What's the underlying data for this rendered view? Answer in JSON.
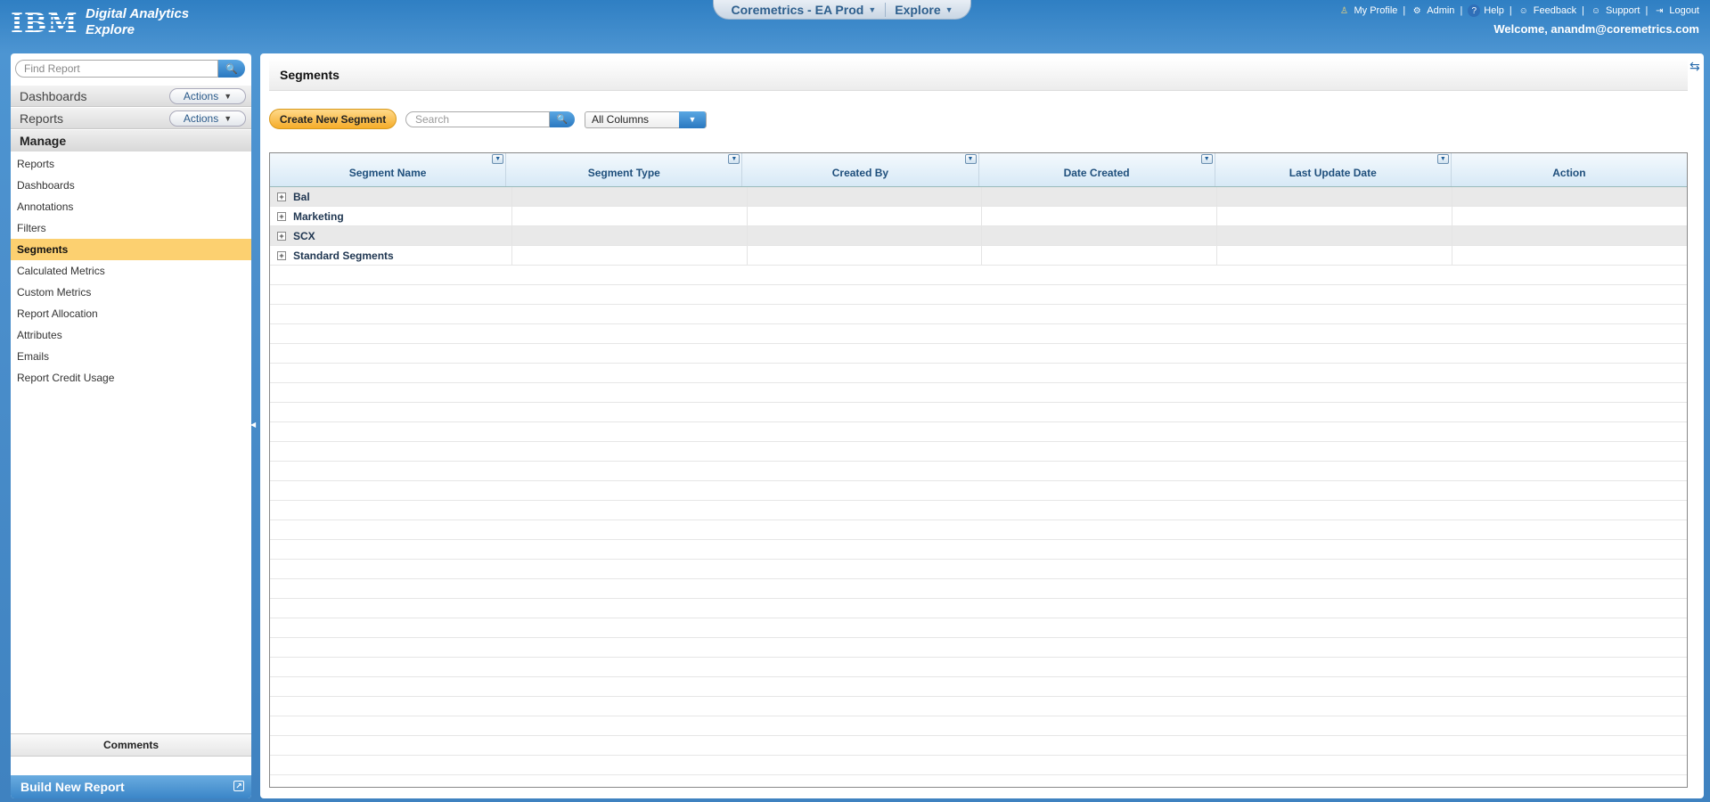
{
  "header": {
    "logo": "IBM",
    "brand_line1": "Digital Analytics",
    "brand_line2": "Explore",
    "center_tabs": [
      {
        "label": "Coremetrics - EA Prod"
      },
      {
        "label": "Explore"
      }
    ],
    "links": [
      {
        "label": "My Profile",
        "icon": "user-icon"
      },
      {
        "label": "Admin",
        "icon": "gear-icon"
      },
      {
        "label": "Help",
        "icon": "help-icon"
      },
      {
        "label": "Feedback",
        "icon": "feedback-icon"
      },
      {
        "label": "Support",
        "icon": "support-icon"
      },
      {
        "label": "Logout",
        "icon": "logout-icon"
      }
    ],
    "welcome": "Welcome, anandm@coremetrics.com"
  },
  "sidebar": {
    "find_placeholder": "Find Report",
    "dashboards_label": "Dashboards",
    "reports_label": "Reports",
    "actions_label": "Actions",
    "manage_label": "Manage",
    "items": [
      {
        "label": "Reports"
      },
      {
        "label": "Dashboards"
      },
      {
        "label": "Annotations"
      },
      {
        "label": "Filters"
      },
      {
        "label": "Segments"
      },
      {
        "label": "Calculated Metrics"
      },
      {
        "label": "Custom Metrics"
      },
      {
        "label": "Report Allocation"
      },
      {
        "label": "Attributes"
      },
      {
        "label": "Emails"
      },
      {
        "label": "Report Credit Usage"
      }
    ],
    "active_item": "Segments",
    "comments_label": "Comments",
    "build_label": "Build New Report"
  },
  "main": {
    "title": "Segments",
    "create_button": "Create New Segment",
    "search_placeholder": "Search",
    "column_filter": "All Columns",
    "columns": [
      "Segment Name",
      "Segment Type",
      "Created By",
      "Date Created",
      "Last Update Date",
      "Action"
    ],
    "rows": [
      {
        "name": "Bal"
      },
      {
        "name": "Marketing"
      },
      {
        "name": "SCX"
      },
      {
        "name": "Standard Segments"
      }
    ]
  },
  "colors": {
    "active_bg": "#fcd070",
    "accent_blue": "#2a78c0",
    "header_blue": "#3f82c0",
    "create_button_orange": "#f5ad2a"
  }
}
